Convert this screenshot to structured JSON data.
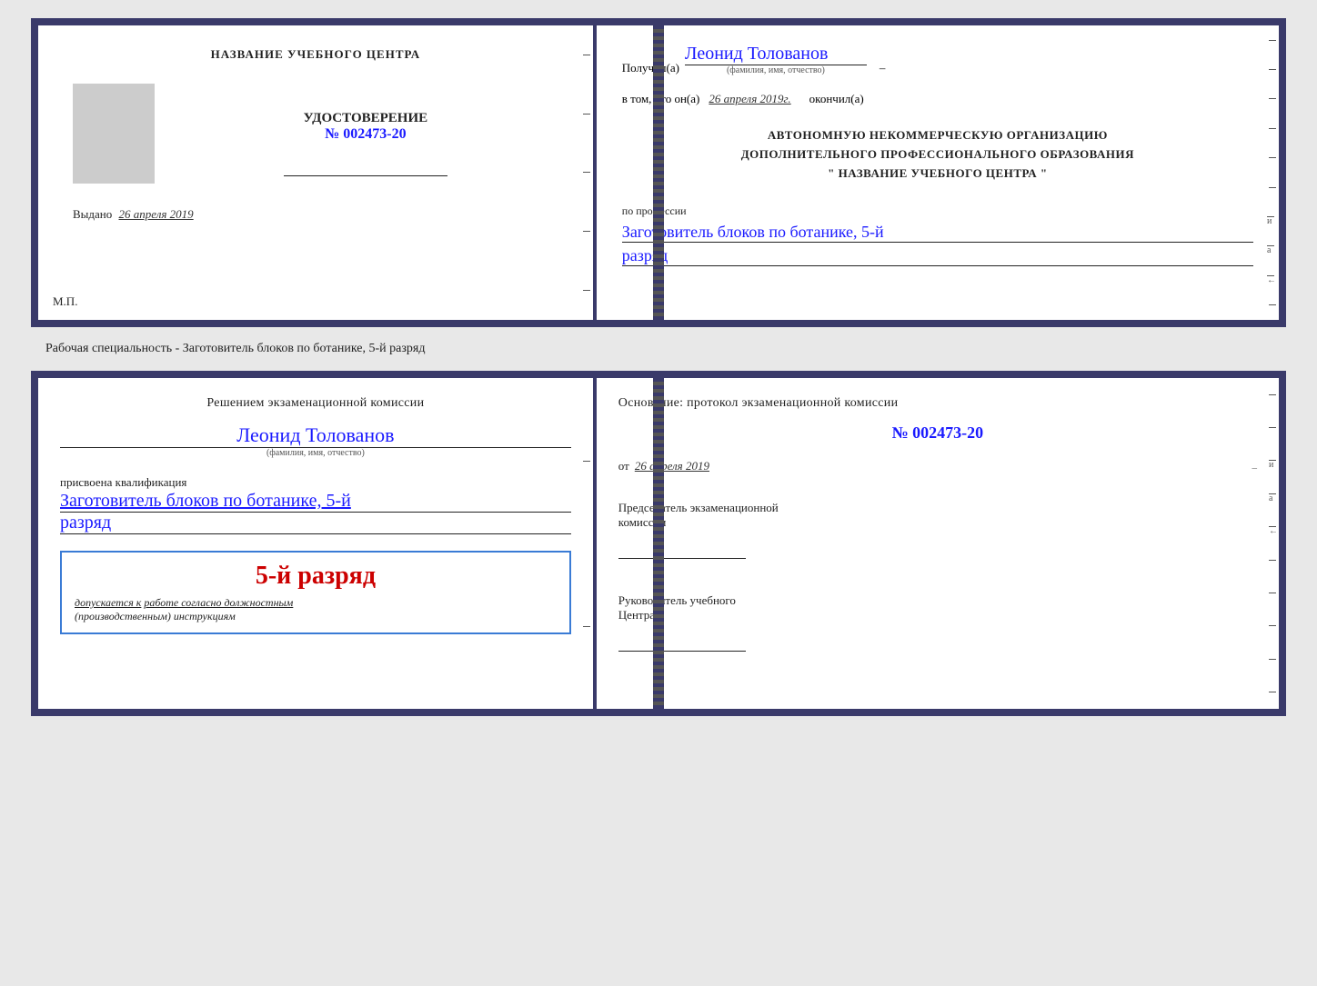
{
  "top_doc": {
    "left": {
      "title": "НАЗВАНИЕ УЧЕБНОГО ЦЕНТРА",
      "cert_title": "УДОСТОВЕРЕНИЕ",
      "cert_number": "№ 002473-20",
      "issued_label": "Выдано",
      "issued_date": "26 апреля 2019",
      "mp_label": "М.П."
    },
    "right": {
      "received_label": "Получил(а)",
      "recipient_name": "Леонид Толованов",
      "name_sub": "(фамилия, имя, отчество)",
      "dash": "–",
      "confirm_label": "в том, что он(а)",
      "confirm_date": "26 апреля 2019г.",
      "finished_label": "окончил(а)",
      "org_line1": "АВТОНОМНУЮ НЕКОММЕРЧЕСКУЮ ОРГАНИЗАЦИЮ",
      "org_line2": "ДОПОЛНИТЕЛЬНОГО ПРОФЕССИОНАЛЬНОГО ОБРАЗОВАНИЯ",
      "org_line3": "\"   НАЗВАНИЕ УЧЕБНОГО ЦЕНТРА   \"",
      "profession_label": "по профессии",
      "profession_value": "Заготовитель блоков по ботанике, 5-й",
      "rank_value": "разряд"
    }
  },
  "specialty_label": "Рабочая специальность - Заготовитель блоков по ботанике, 5-й разряд",
  "bottom_doc": {
    "left": {
      "decision_text": "Решением экзаменационной комиссии",
      "person_name": "Леонид Толованов",
      "name_sub": "(фамилия, имя, отчество)",
      "qualification_label": "присвоена квалификация",
      "qualification_value": "Заготовитель блоков по ботанике, 5-й",
      "rank_value": "разряд",
      "rank_box_main": "5-й разряд",
      "rank_box_sub_prefix": "допускается к",
      "rank_box_sub_underline": "работе согласно должностным",
      "rank_box_sub_line2": "(производственным) инструкциям"
    },
    "right": {
      "basis_text": "Основание: протокол экзаменационной  комиссии",
      "protocol_number": "№  002473-20",
      "protocol_date_prefix": "от",
      "protocol_date": "26 апреля 2019",
      "chairman_title": "Председатель экзаменационной",
      "chairman_title2": "комиссии",
      "center_head_title": "Руководитель учебного",
      "center_head_title2": "Центра"
    }
  }
}
